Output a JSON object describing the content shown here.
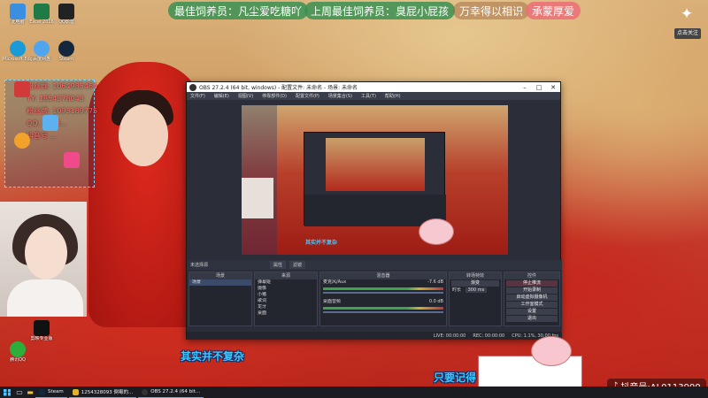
{
  "banner": {
    "best_fan": "最佳饲养员：凡尘爱吃糖吖",
    "last_week_best_fan": "上周最佳饲养员：臭屁小屁孩",
    "motto_1": "万幸得以相识",
    "motto_2": "承蒙厚爱",
    "badge_text": "点击关注"
  },
  "desktop_icons": [
    {
      "label": "此电脑"
    },
    {
      "label": "Excel 2016"
    },
    {
      "label": "QQ影音"
    },
    {
      "label": "Microsoft Edge"
    },
    {
      "label": "百度网盘"
    },
    {
      "label": "Steam"
    },
    {
      "label": "快剪辑"
    },
    {
      "label": "WPS"
    },
    {
      "label": "KK录像机"
    },
    {
      "label": "回收站"
    },
    {
      "label": "剪映专业版"
    },
    {
      "label": "腾讯QQ"
    }
  ],
  "overlay": {
    "lines": [
      "粉丝群: 1064985464",
      "YY: 1854378043",
      "粉丝牌: 1093189775",
      "QQ: 2563...",
      "抖音号 ..."
    ]
  },
  "obs": {
    "title": "OBS 27.2.4 (64 bit, windows) - 配置文件: 未命名 - 场景: 未命名",
    "menus": [
      "文件(F)",
      "编辑(E)",
      "视图(V)",
      "停靠部件(D)",
      "配置文件(P)",
      "场景集合(S)",
      "工具(T)",
      "帮助(H)"
    ],
    "source_hint": "未选择源",
    "props_label": "属性",
    "filters_label": "滤镜",
    "docks": {
      "scenes": {
        "title": "场景",
        "items": [
          "场景"
        ]
      },
      "sources": {
        "title": "来源",
        "items": [
          "弹幕姬",
          "摄像",
          "小猪",
          "歌词",
          "龙牙",
          "桌面"
        ]
      },
      "mixer": {
        "title": "混音器",
        "channels": [
          {
            "name": "麦克风/Aux",
            "db": "-7.6 dB"
          },
          {
            "name": "桌面音频",
            "db": "0.0 dB"
          }
        ]
      },
      "transitions": {
        "title": "转场特效",
        "type": "渐变",
        "duration_label": "时长",
        "duration_value": "300 ms"
      },
      "controls": {
        "title": "控件",
        "buttons": [
          "停止推流",
          "开始录制",
          "启动虚拟摄像机",
          "工作室模式",
          "设置",
          "退出"
        ]
      }
    },
    "status": {
      "live": "LIVE: 00:00:00",
      "rec": "REC: 00:00:00",
      "cpu": "CPU: 1.1%, 30.00 fps"
    }
  },
  "captions": {
    "main": "其实并不复杂",
    "secondary": "只要记得"
  },
  "tiktok_id": "抖音号:AL0113999",
  "taskbar": {
    "tasks": [
      {
        "label": "Steam"
      },
      {
        "label": "1254328093 倒霉的..."
      },
      {
        "label": "OBS 27.2.4 (64 bit..."
      }
    ]
  },
  "colors": {
    "caption_blue": "#3fc7ff",
    "banner_green": "#3a9152",
    "banner_pink": "#eb6e78",
    "obs_dark": "#2b2e38"
  }
}
